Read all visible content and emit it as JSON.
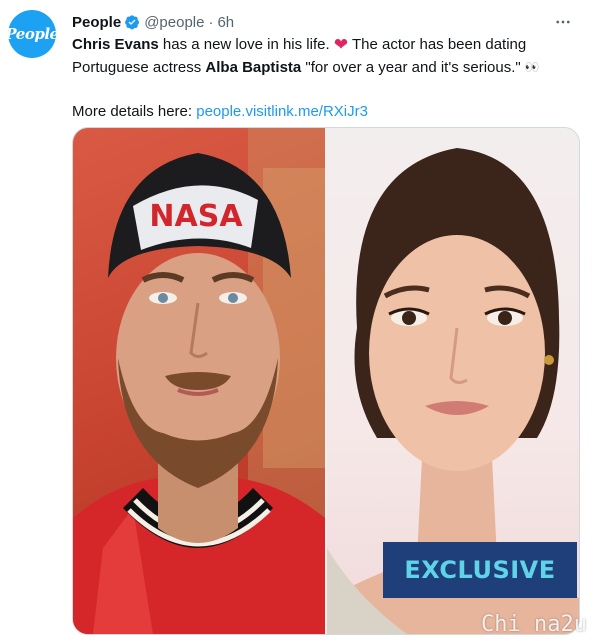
{
  "account": {
    "display_name": "People",
    "handle": "@people",
    "separator": "·",
    "time": "6h",
    "avatar_text": "People",
    "verified": true
  },
  "more_icon": "more-horizontal-icon",
  "tweet": {
    "part1_bold": "Chris Evans",
    "part2": " has a new love in his life. ",
    "heart": "❤",
    "part3": " The actor has been dating Portuguese actress ",
    "part4_bold": "Alba Baptista",
    "part5": " \"for over a year and it's serious.\" ",
    "eyes": "👀",
    "details_label": "More details here: ",
    "link_text": "people.visitlink.me/RXiJr3"
  },
  "media": {
    "left_photo_icon": "man-portrait-photo",
    "left_cap_text": "NASA",
    "right_photo_icon": "woman-portrait-photo",
    "badge_text": "EXCLUSIVE"
  },
  "watermark": "Chi na2u",
  "colors": {
    "accent": "#1d9bf0",
    "heart": "#e0245e",
    "badge_bg": "#1f3f7a",
    "badge_text": "#5fd3e8"
  }
}
